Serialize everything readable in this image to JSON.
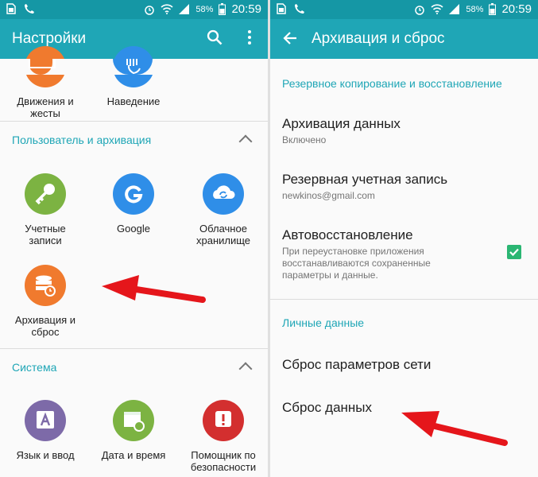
{
  "status": {
    "battery": "58%",
    "time": "20:59"
  },
  "left": {
    "title": "Настройки",
    "top_tiles": [
      {
        "label": "Движения и\nжесты"
      },
      {
        "label": "Наведение"
      }
    ],
    "section1": {
      "header": "Пользователь и архивация",
      "tiles": [
        {
          "label": "Учетные\nзаписи",
          "color": "#7cb342"
        },
        {
          "label": "Google",
          "color": "#2f8ee8"
        },
        {
          "label": "Облачное\nхранилище",
          "color": "#2f8ee8"
        },
        {
          "label": "Архивация и\nсброс",
          "color": "#f07a2e"
        }
      ]
    },
    "section2": {
      "header": "Система",
      "tiles": [
        {
          "label": "Язык и ввод",
          "color": "#7d6aa8"
        },
        {
          "label": "Дата и время",
          "color": "#7cb342"
        },
        {
          "label": "Помощник по\nбезопасности",
          "color": "#d32f2f"
        }
      ]
    }
  },
  "right": {
    "title": "Архивация и сброс",
    "section1": "Резервное копирование и восстановление",
    "items1": [
      {
        "title": "Архивация данных",
        "sub": "Включено"
      },
      {
        "title": "Резервная учетная запись",
        "sub": "newkinos@gmail.com"
      },
      {
        "title": "Автовосстановление",
        "sub": "При переустановке приложения\nвосстанавливаются сохраненные\nпараметры и данные."
      }
    ],
    "section2": "Личные данные",
    "items2": [
      {
        "title": "Сброс параметров сети"
      },
      {
        "title": "Сброс данных"
      }
    ]
  }
}
